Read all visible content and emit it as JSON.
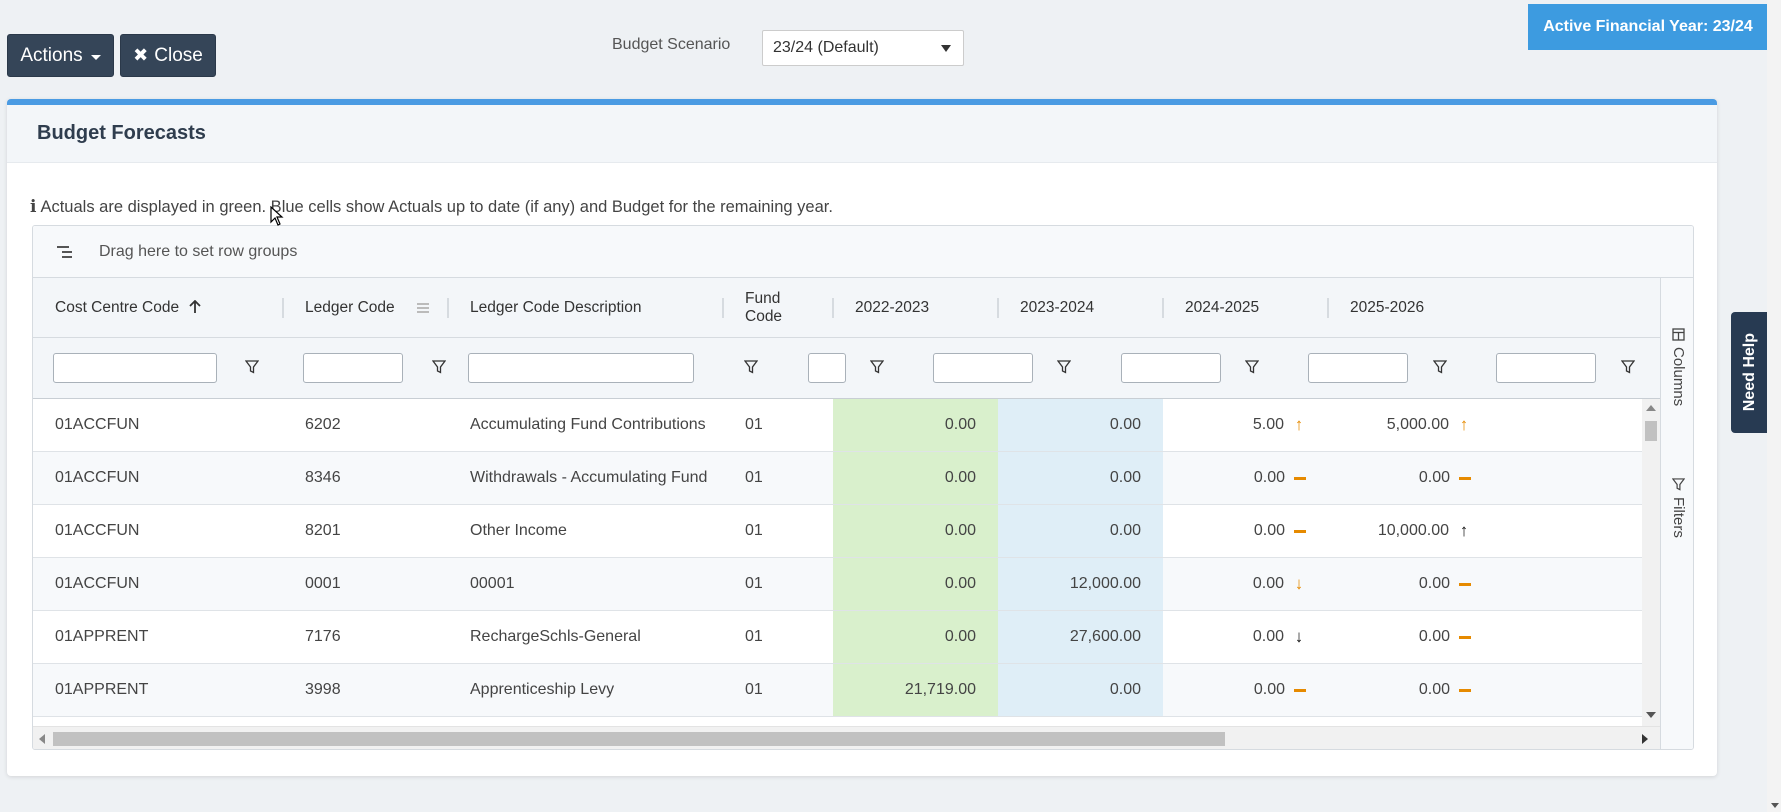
{
  "toolbar": {
    "actions_label": "Actions",
    "close_label": "Close"
  },
  "scenario": {
    "label": "Budget Scenario",
    "value": "23/24 (Default)"
  },
  "financial_year_badge": "Active Financial Year: 23/24",
  "panel": {
    "title": "Budget Forecasts",
    "info": "Actuals are displayed in green. Blue cells show Actuals up to date (if any) and Budget for the remaining year."
  },
  "grid": {
    "group_bar_text": "Drag here to set row groups",
    "columns": {
      "cost_centre": "Cost Centre Code",
      "ledger_code": "Ledger Code",
      "ledger_desc": "Ledger Code Description",
      "fund_code": "Fund Code",
      "y2022": "2022-2023",
      "y2023": "2023-2024",
      "y2024": "2024-2025",
      "y2025": "2025-2026"
    },
    "rows": [
      {
        "cost_centre": "01ACCFUN",
        "ledger_code": "6202",
        "desc": "Accumulating Fund Contributions",
        "fund": "01",
        "y2022": "0.00",
        "y2023": "0.00",
        "y2024": "5.00",
        "y2024_trend": "up-orange",
        "y2025": "5,000.00",
        "y2025_trend": "up-orange"
      },
      {
        "cost_centre": "01ACCFUN",
        "ledger_code": "8346",
        "desc": "Withdrawals - Accumulating Fund",
        "fund": "01",
        "y2022": "0.00",
        "y2023": "0.00",
        "y2024": "0.00",
        "y2024_trend": "flat",
        "y2025": "0.00",
        "y2025_trend": "flat"
      },
      {
        "cost_centre": "01ACCFUN",
        "ledger_code": "8201",
        "desc": "Other Income",
        "fund": "01",
        "y2022": "0.00",
        "y2023": "0.00",
        "y2024": "0.00",
        "y2024_trend": "flat",
        "y2025": "10,000.00",
        "y2025_trend": "up-black"
      },
      {
        "cost_centre": "01ACCFUN",
        "ledger_code": "0001",
        "desc": "00001",
        "fund": "01",
        "y2022": "0.00",
        "y2023": "12,000.00",
        "y2024": "0.00",
        "y2024_trend": "down-orange",
        "y2025": "0.00",
        "y2025_trend": "flat"
      },
      {
        "cost_centre": "01APPRENT",
        "ledger_code": "7176",
        "desc": "RechargeSchls-General",
        "fund": "01",
        "y2022": "0.00",
        "y2023": "27,600.00",
        "y2024": "0.00",
        "y2024_trend": "down-black",
        "y2025": "0.00",
        "y2025_trend": "flat"
      },
      {
        "cost_centre": "01APPRENT",
        "ledger_code": "3998",
        "desc": "Apprenticeship Levy",
        "fund": "01",
        "y2022": "21,719.00",
        "y2023": "0.00",
        "y2024": "0.00",
        "y2024_trend": "flat",
        "y2025": "0.00",
        "y2025_trend": "flat"
      }
    ],
    "side_tabs": {
      "columns": "Columns",
      "filters": "Filters"
    }
  },
  "need_help": "Need Help",
  "colors": {
    "actual_green": "#d9f0cc",
    "budget_blue": "#dfeef7",
    "accent": "#3d9be0",
    "button_dark": "#354558"
  },
  "icons": [
    "caret-down-icon",
    "close-icon",
    "info-icon",
    "row-group-icon",
    "sort-up-icon",
    "column-menu-icon",
    "filter-icon",
    "trend-up-icon",
    "trend-down-icon",
    "trend-flat-icon",
    "columns-icon"
  ]
}
